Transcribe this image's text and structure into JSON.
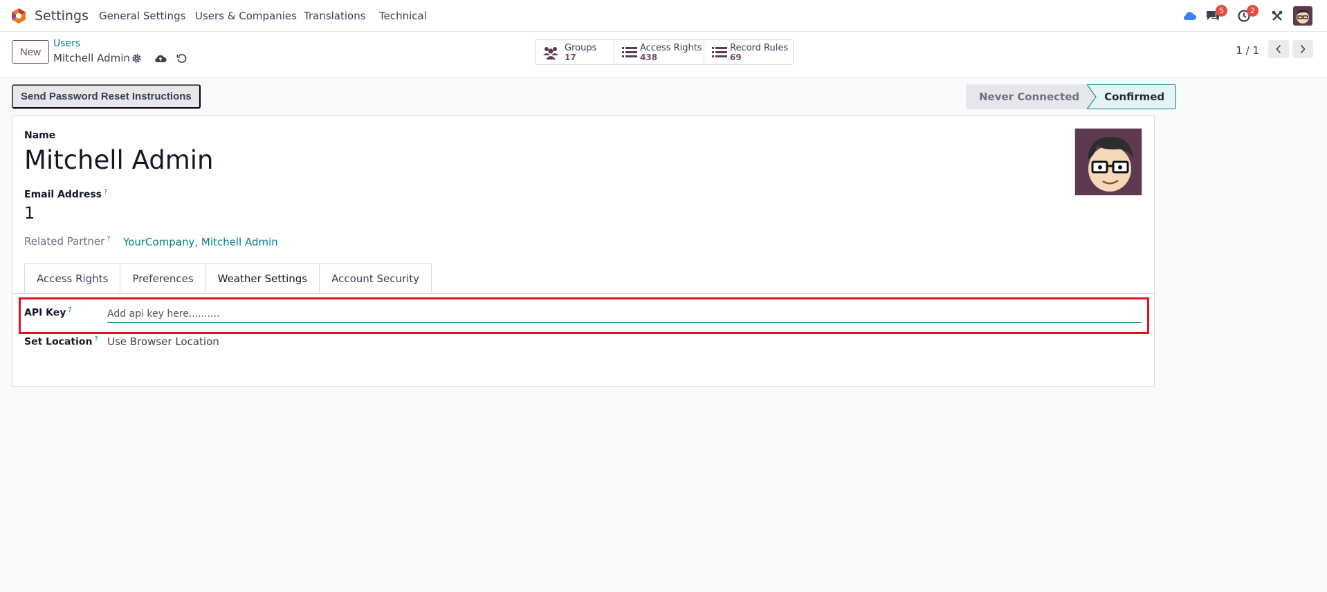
{
  "navbar": {
    "app_name": "Settings",
    "menu": [
      "General Settings",
      "Users & Companies",
      "Translations",
      "Technical"
    ],
    "chat_badge": "5",
    "activity_badge": "2"
  },
  "control_panel": {
    "new_label": "New",
    "breadcrumb_parent": "Users",
    "breadcrumb_current": "Mitchell Admin",
    "smart_buttons": [
      {
        "label": "Groups",
        "value": "17",
        "icon": "users-icon"
      },
      {
        "label": "Access Rights",
        "value": "438",
        "icon": "list-icon"
      },
      {
        "label": "Record Rules",
        "value": "69",
        "icon": "list-icon"
      }
    ],
    "pager": "1 / 1"
  },
  "statusbar": {
    "reset_label": "Send Password Reset Instructions",
    "stages": [
      "Never Connected",
      "Confirmed"
    ],
    "active_stage": "Confirmed"
  },
  "form": {
    "name_label": "Name",
    "name_value": "Mitchell Admin",
    "email_label": "Email Address",
    "help_mark": "?",
    "email_value": "1",
    "partner_label": "Related Partner",
    "partner_value": "YourCompany, Mitchell Admin",
    "tabs": [
      "Access Rights",
      "Preferences",
      "Weather Settings",
      "Account Security"
    ],
    "active_tab": "Weather Settings",
    "api_key_label": "API Key",
    "api_key_placeholder": "Add api key here..........",
    "api_key_value": "",
    "location_label": "Set Location",
    "location_value": "Use Browser Location"
  },
  "colors": {
    "brand": "#714b67",
    "accent": "#017e84",
    "highlight": "#e3101e",
    "badge": "#e74c3c"
  }
}
